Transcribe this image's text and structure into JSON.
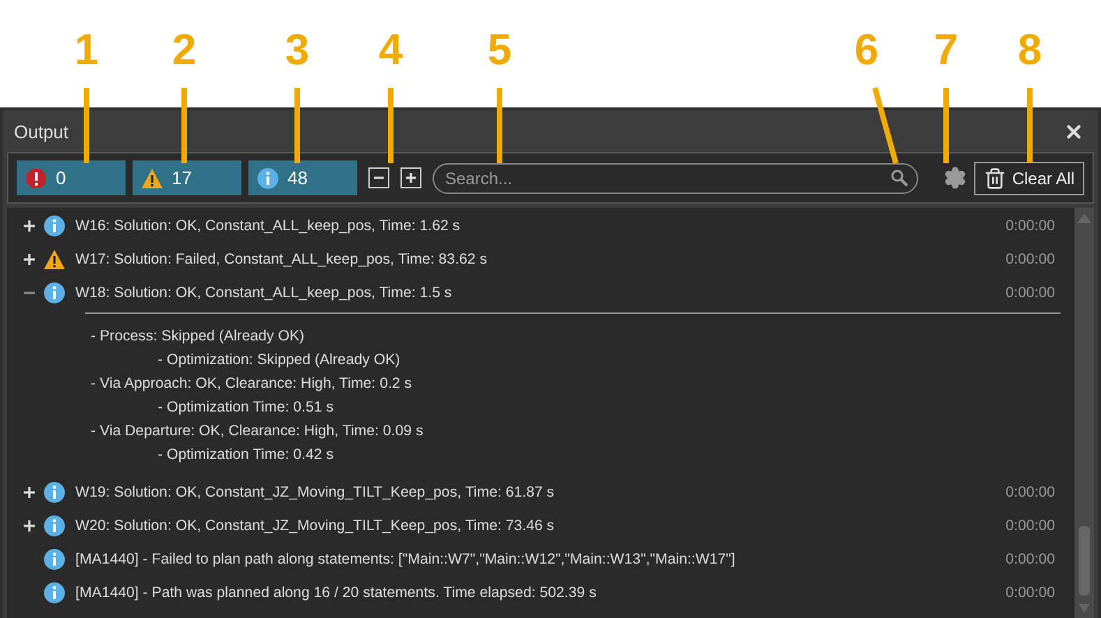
{
  "callouts": [
    {
      "label": "1"
    },
    {
      "label": "2"
    },
    {
      "label": "3"
    },
    {
      "label": "4"
    },
    {
      "label": "5"
    },
    {
      "label": "6"
    },
    {
      "label": "7"
    },
    {
      "label": "8"
    }
  ],
  "window": {
    "title": "Output"
  },
  "filters": [
    {
      "kind": "error",
      "count": "0"
    },
    {
      "kind": "warning",
      "count": "17"
    },
    {
      "kind": "info",
      "count": "48"
    }
  ],
  "search": {
    "placeholder": "Search..."
  },
  "clear_button": "Clear All",
  "rows": [
    {
      "kind": "info",
      "expanded": false,
      "text": "W16: Solution: OK, Constant_ALL_keep_pos, Time: 1.62 s",
      "time": "0:00:00"
    },
    {
      "kind": "warning",
      "expanded": false,
      "text": "W17: Solution: Failed, Constant_ALL_keep_pos, Time: 83.62 s",
      "time": "0:00:00"
    },
    {
      "kind": "info",
      "expanded": true,
      "text": "W18: Solution: OK, Constant_ALL_keep_pos, Time: 1.5 s",
      "time": "0:00:00",
      "details": [
        {
          "text": "- Process: Skipped (Already OK)",
          "children": [
            {
              "text": "- Optimization: Skipped (Already OK)"
            }
          ]
        },
        {
          "text": "- Via Approach: OK, Clearance: High, Time: 0.2 s",
          "children": [
            {
              "text": "- Optimization Time: 0.51 s"
            }
          ]
        },
        {
          "text": "- Via Departure: OK, Clearance: High, Time: 0.09 s",
          "children": [
            {
              "text": "- Optimization Time: 0.42 s"
            }
          ]
        }
      ]
    },
    {
      "kind": "info",
      "expanded": false,
      "text": "W19: Solution: OK, Constant_JZ_Moving_TILT_Keep_pos, Time: 61.87 s",
      "time": "0:00:00"
    },
    {
      "kind": "info",
      "expanded": false,
      "text": "W20: Solution: OK, Constant_JZ_Moving_TILT_Keep_pos, Time: 73.46 s",
      "time": "0:00:00"
    },
    {
      "kind": "info",
      "text": "[MA1440] - Failed to plan path along statements: [\"Main::W7\",\"Main::W12\",\"Main::W13\",\"Main::W17\"]",
      "time": "0:00:00"
    },
    {
      "kind": "info",
      "text": "[MA1440] - Path was planned along 16 / 20 statements. Time elapsed: 502.39 s",
      "time": "0:00:00"
    }
  ]
}
